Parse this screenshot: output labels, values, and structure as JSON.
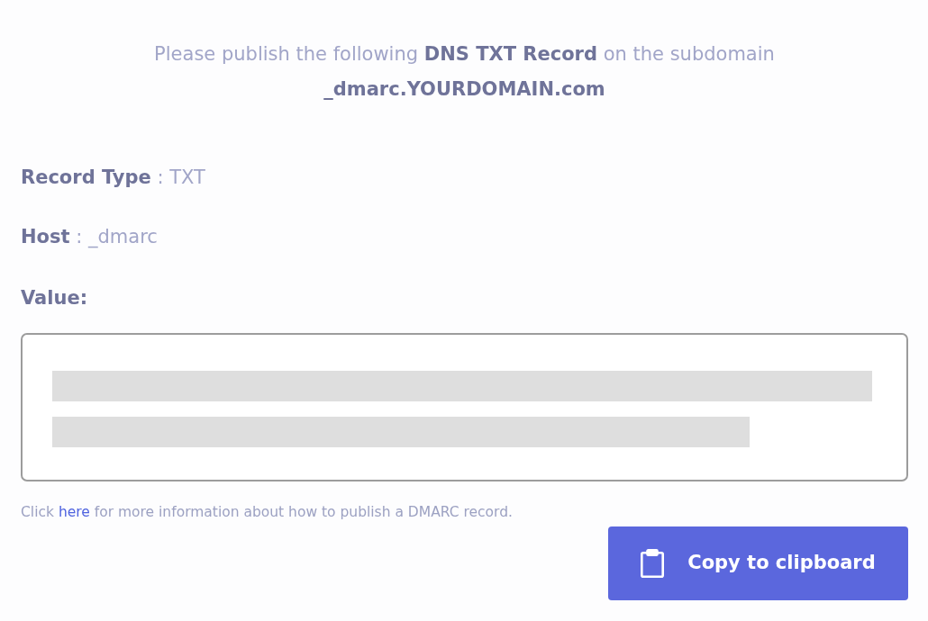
{
  "instruction": {
    "lines": [
      "Please publish the following **DNS TXT Record** on the subdomain",
      "**_dmarc.YOURDOMAIN.com**"
    ]
  },
  "details": [
    "**Record Type** : TXT",
    "**Host** : _dmarc"
  ],
  "value_label": "Value:",
  "value_field": {
    "redacted": true
  },
  "help": {
    "before": "Click ",
    "link": "here",
    "after": " for more information about how to publish a DMARC record."
  },
  "copy_button": {
    "label": "Copy to clipboard"
  }
}
